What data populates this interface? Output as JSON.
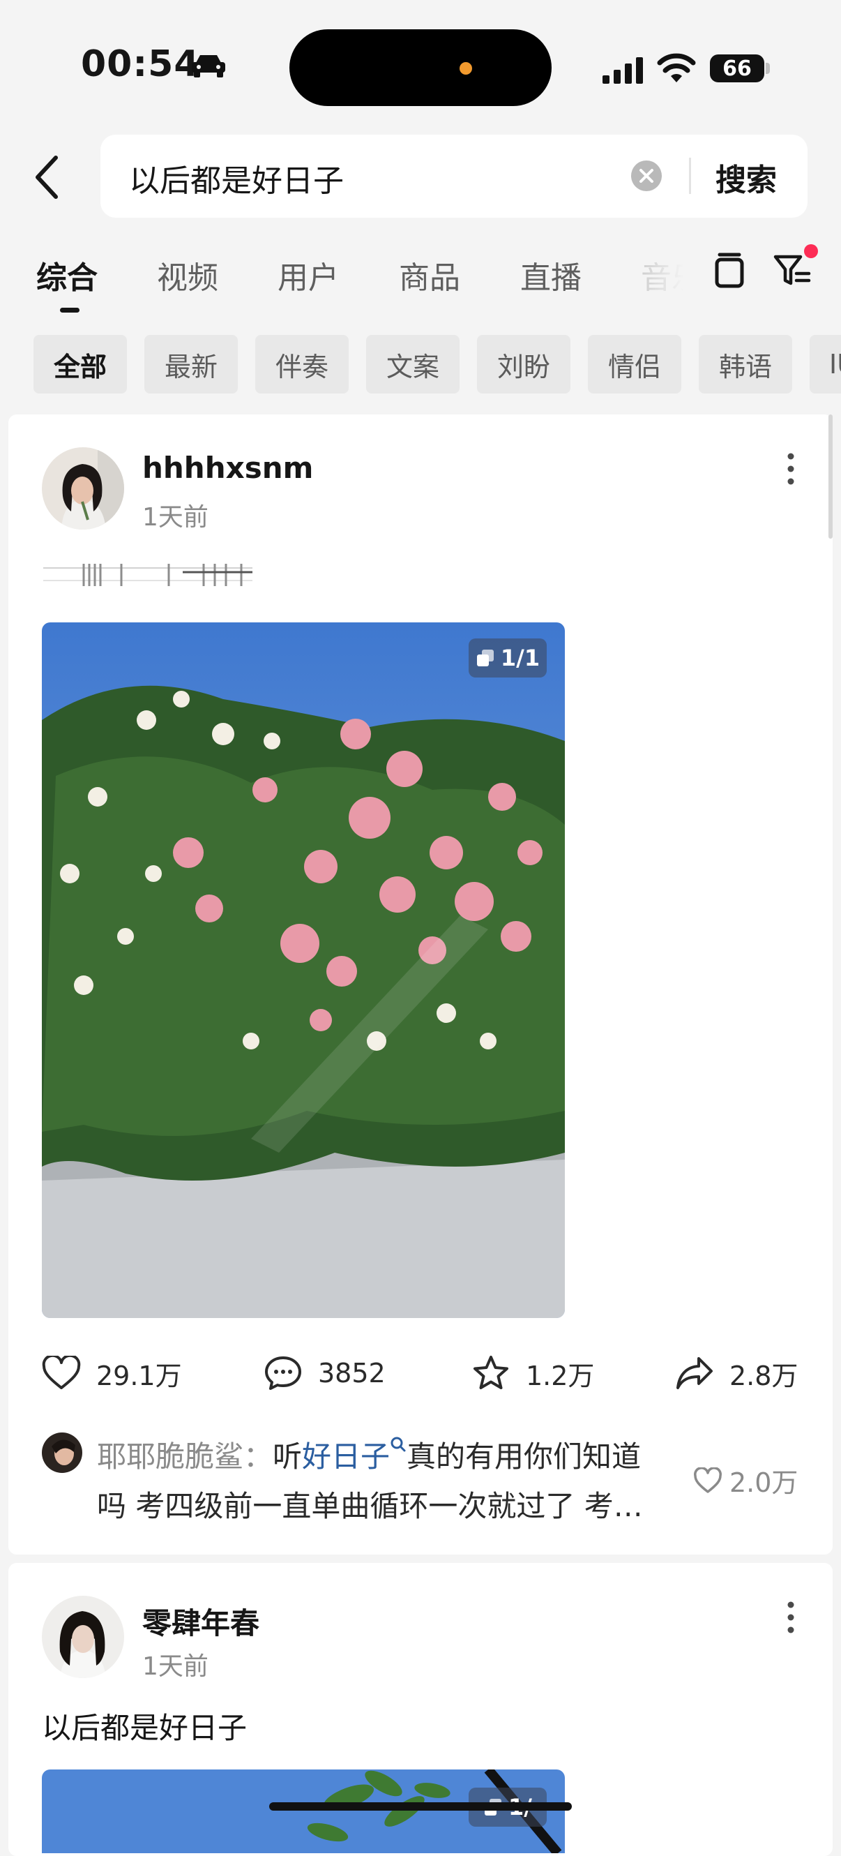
{
  "status_bar": {
    "time": "00:54",
    "battery": "66"
  },
  "search": {
    "query": "以后都是好日子",
    "button_label": "搜索"
  },
  "tabs": [
    {
      "label": "综合",
      "active": true
    },
    {
      "label": "视频"
    },
    {
      "label": "用户"
    },
    {
      "label": "商品"
    },
    {
      "label": "直播"
    },
    {
      "label": "音乐"
    }
  ],
  "chips": [
    "全部",
    "最新",
    "伴奏",
    "文案",
    "刘盼",
    "情侣",
    "韩语",
    "IU"
  ],
  "posts": [
    {
      "username": "hhhhxsnm",
      "time": "1天前",
      "image_badge": "1/1",
      "actions": {
        "likes": "29.1万",
        "comments": "3852",
        "favorites": "1.2万",
        "shares": "2.8万"
      },
      "top_comment": {
        "author": "耶耶脆脆鲨：",
        "text_before": "听",
        "link": "好日子",
        "text_after": "真的有用你们知道",
        "line2": "吗 考四级前一直单曲循环一次就过了 考…",
        "likes": "2.0万"
      }
    },
    {
      "username": "零肆年春",
      "time": "1天前",
      "caption": "以后都是好日子",
      "image_badge": "1/"
    }
  ],
  "colors": {
    "accent_red": "#fd2c55",
    "link_blue": "#2b5ea0",
    "background": "#f4f4f4"
  }
}
